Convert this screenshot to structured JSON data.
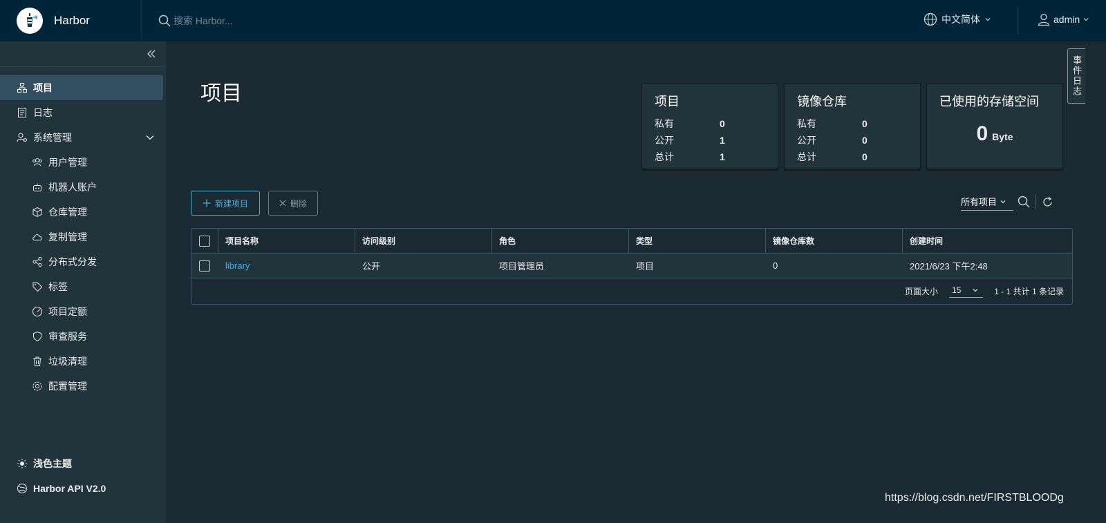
{
  "header": {
    "brand": "Harbor",
    "search_placeholder": "搜索 Harbor...",
    "language": "中文简体",
    "user": "admin"
  },
  "sidebar": {
    "items": [
      {
        "label": "项目",
        "icon": "projects-icon",
        "active": true
      },
      {
        "label": "日志",
        "icon": "logs-icon"
      },
      {
        "label": "系统管理",
        "icon": "admin-icon"
      }
    ],
    "sub_items": [
      {
        "label": "用户管理",
        "icon": "users-icon"
      },
      {
        "label": "机器人账户",
        "icon": "robot-icon"
      },
      {
        "label": "仓库管理",
        "icon": "box-icon"
      },
      {
        "label": "复制管理",
        "icon": "cloud-icon"
      },
      {
        "label": "分布式分发",
        "icon": "share-icon"
      },
      {
        "label": "标签",
        "icon": "tag-icon"
      },
      {
        "label": "项目定额",
        "icon": "quota-icon"
      },
      {
        "label": "审查服务",
        "icon": "shield-icon"
      },
      {
        "label": "垃圾清理",
        "icon": "trash-icon"
      },
      {
        "label": "配置管理",
        "icon": "gear-icon"
      }
    ],
    "bottom": [
      {
        "label": "浅色主题",
        "icon": "sun-icon"
      },
      {
        "label": "Harbor API V2.0",
        "icon": "api-icon"
      }
    ]
  },
  "main": {
    "title": "项目",
    "cards": {
      "projects": {
        "title": "项目",
        "rows": [
          {
            "k": "私有",
            "v": "0"
          },
          {
            "k": "公开",
            "v": "1"
          },
          {
            "k": "总计",
            "v": "1"
          }
        ]
      },
      "repos": {
        "title": "镜像仓库",
        "rows": [
          {
            "k": "私有",
            "v": "0"
          },
          {
            "k": "公开",
            "v": "0"
          },
          {
            "k": "总计",
            "v": "0"
          }
        ]
      },
      "storage": {
        "title": "已使用的存储空间",
        "value": "0",
        "unit": "Byte"
      }
    },
    "buttons": {
      "new_project": "新建项目",
      "delete": "删除"
    },
    "filter": "所有项目",
    "table": {
      "headers": [
        "项目名称",
        "访问级别",
        "角色",
        "类型",
        "镜像仓库数",
        "创建时间"
      ],
      "rows": [
        {
          "name": "library",
          "access": "公开",
          "role": "项目管理员",
          "type": "项目",
          "repo_count": "0",
          "created": "2021/6/23 下午2:48"
        }
      ],
      "footer": {
        "page_size_label": "页面大小",
        "page_size": "15",
        "summary": "1 - 1 共计 1 条记录"
      }
    },
    "side_tab": "事件日志"
  },
  "watermark": "https://blog.csdn.net/FIRSTBLOODg",
  "colors": {
    "header_bg": "#002538",
    "sidebar_bg": "#21333b",
    "main_bg": "#1b2a32",
    "accent": "#49afd9"
  }
}
